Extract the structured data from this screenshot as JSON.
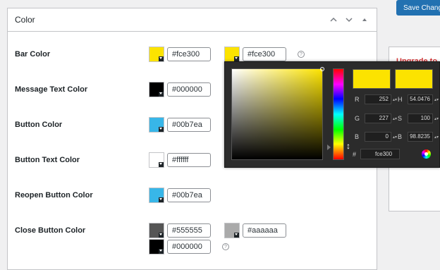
{
  "panel": {
    "title": "Color"
  },
  "rows": [
    {
      "label": "Bar Color",
      "colors": [
        {
          "value": "#fce300"
        },
        {
          "value": "#fce300"
        }
      ]
    },
    {
      "label": "Message Text Color",
      "colors": [
        {
          "value": "#000000"
        }
      ]
    },
    {
      "label": "Button Color",
      "colors": [
        {
          "value": "#00b7ea"
        }
      ]
    },
    {
      "label": "Button Text Color",
      "colors": [
        {
          "value": "#ffffff"
        }
      ]
    },
    {
      "label": "Reopen Button Color",
      "colors": [
        {
          "value": "#00b7ea"
        }
      ]
    },
    {
      "label": "Close Button Color",
      "colors": [
        {
          "value": "#555555"
        },
        {
          "value": "#aaaaaa"
        },
        {
          "value": "#000000"
        }
      ]
    }
  ],
  "help_glyph": "?",
  "save_button": "Save Chang",
  "sidebar": {
    "title": "Upgrade to"
  },
  "picker": {
    "r_label": "R",
    "r_value": "252",
    "g_label": "G",
    "g_value": "227",
    "b_label": "B",
    "b_value": "0",
    "h_label": "H",
    "h_value": "54.0476",
    "s_label": "S",
    "s_value": "100",
    "bv_label": "B",
    "bv_value": "98.8235",
    "hex_label": "#",
    "hex_value": "fce300",
    "spin_glyph": "▴▾"
  },
  "colors": {
    "bar": "#fce300",
    "message_text": "#000000",
    "button": "#00b7ea",
    "button_text": "#ffffff",
    "reopen_button": "#00b7ea",
    "close_button": "#555555",
    "close_button_hover": "#aaaaaa",
    "close_button_icon": "#000000",
    "accent": "#2271b1",
    "upgrade_red": "#d63638"
  }
}
